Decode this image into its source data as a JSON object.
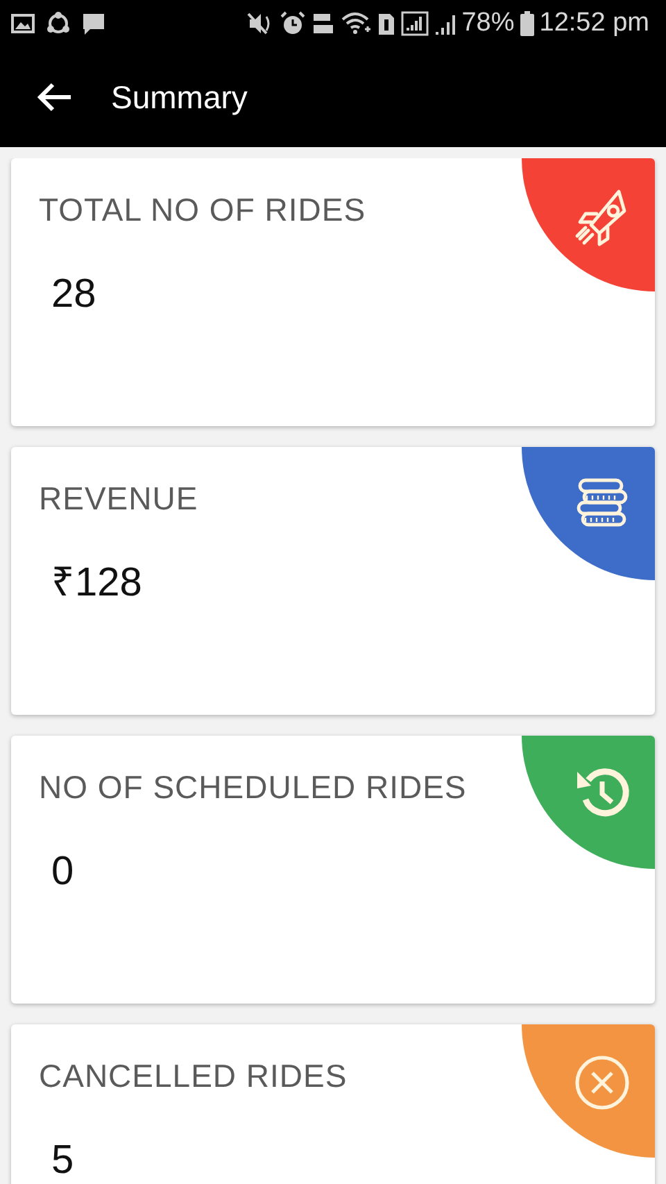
{
  "status_bar": {
    "battery": "78%",
    "time": "12:52 pm"
  },
  "app_bar": {
    "title": "Summary"
  },
  "cards": [
    {
      "title": "TOTAL NO OF RIDES",
      "value": "28",
      "kind": "rocket",
      "color": "#f44336"
    },
    {
      "title": "REVENUE",
      "value": "₹128",
      "kind": "coins",
      "color": "#3d6cc9"
    },
    {
      "title": "NO OF SCHEDULED RIDES",
      "value": "0",
      "kind": "history",
      "color": "#3fae5a"
    },
    {
      "title": "CANCELLED RIDES",
      "value": "5",
      "kind": "cancel",
      "color": "#f39443"
    }
  ]
}
